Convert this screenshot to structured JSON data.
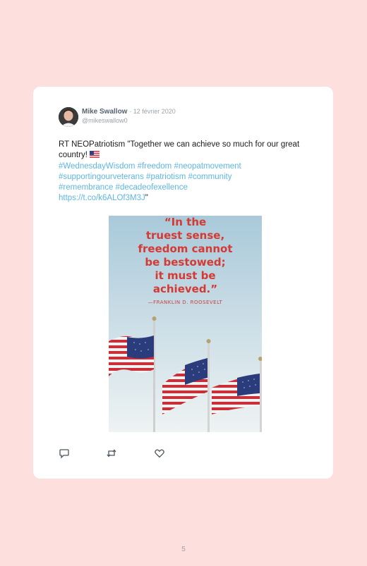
{
  "tweet": {
    "author_name": "Mike Swallow",
    "date": "· 12 février 2020",
    "handle": "@mikeswallow0",
    "text_prefix": "RT NEOPatriotism \"Together we can achieve so much for our great country! ",
    "flag_emoji": "🇺🇸",
    "hashtags": [
      "#WednesdayWisdom",
      "#freedom",
      "#neopatmovement",
      "#supportingourveterans",
      "#patriotism",
      "#community",
      "#remembrance",
      "#decadeofexellence"
    ],
    "link": "https://t.co/k6ALOf3M3J",
    "text_suffix": "\""
  },
  "media": {
    "quote_lines": [
      "“In the",
      "truest sense,",
      "freedom cannot",
      "be bestowed;",
      "it must be",
      "achieved.”"
    ],
    "quote_author": "—FRANKLIN D. ROOSEVELT",
    "sky_top_color": "#a9c9da",
    "sky_bottom_color": "#eef3f3"
  },
  "actions": [
    "reply-icon",
    "retweet-icon",
    "like-icon"
  ],
  "page_number": "5",
  "colors": {
    "background": "#fde0de",
    "link": "#5eb6e4",
    "quote_red": "#d43a33",
    "icon": "#4a5560"
  }
}
